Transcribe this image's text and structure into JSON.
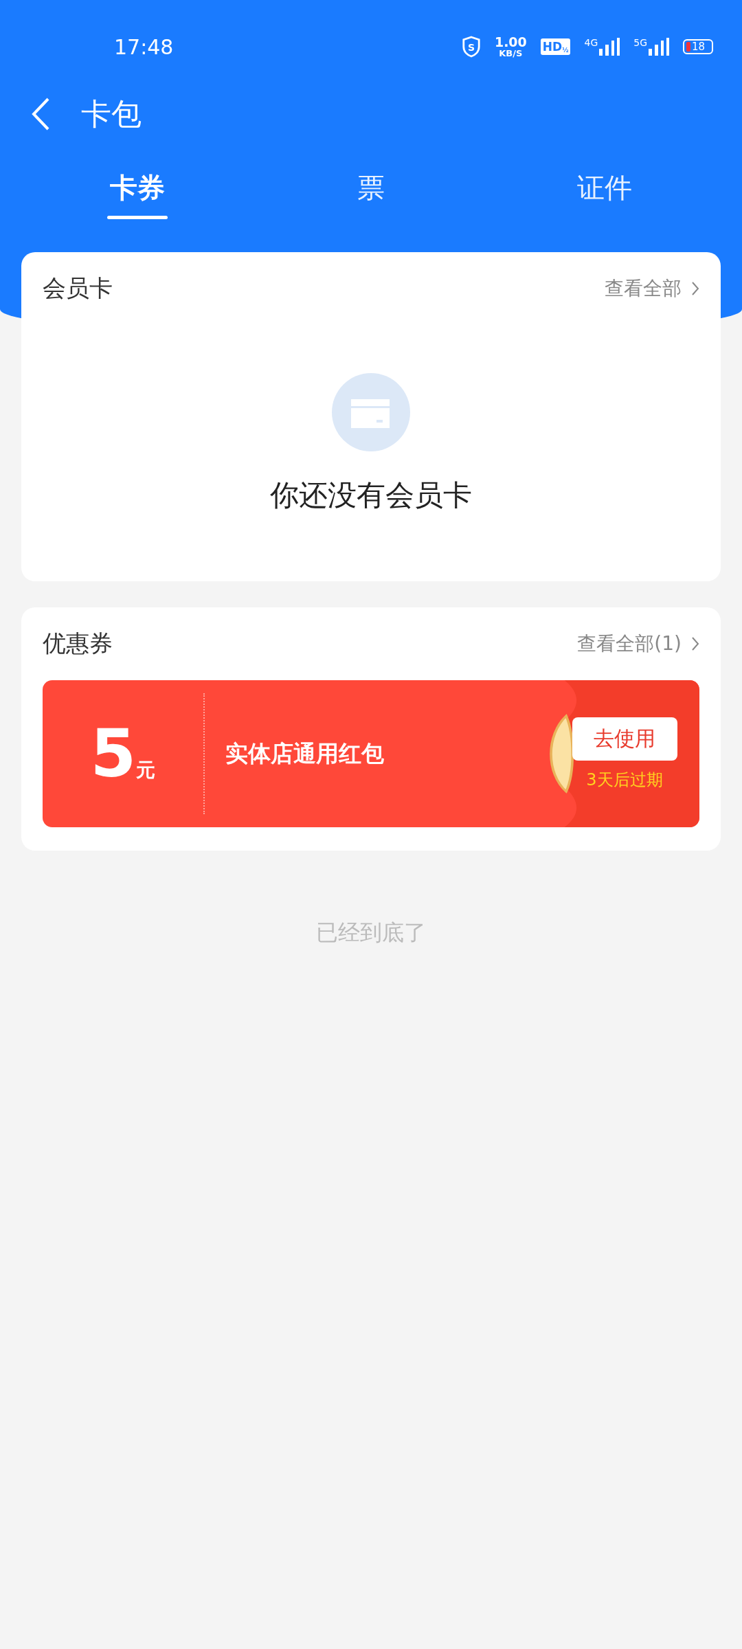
{
  "status_bar": {
    "time": "17:48",
    "shield_letter": "S",
    "speed_value": "1.00",
    "speed_unit": "KB/S",
    "hd_label": "HD",
    "hd_fraction": "½",
    "network_1": "4G",
    "network_2": "5G",
    "battery": "18"
  },
  "header": {
    "title": "卡包"
  },
  "tabs": [
    {
      "label": "卡券",
      "selected": true
    },
    {
      "label": "票",
      "selected": false
    },
    {
      "label": "证件",
      "selected": false
    }
  ],
  "membership": {
    "title": "会员卡",
    "view_all": "查看全部",
    "empty_text": "你还没有会员卡"
  },
  "coupons": {
    "title": "优惠券",
    "view_all": "查看全部(1)",
    "items": [
      {
        "amount": "5",
        "unit": "元",
        "name": "实体店通用红包",
        "action": "去使用",
        "expiry": "3天后过期"
      }
    ]
  },
  "footer": "已经到底了"
}
